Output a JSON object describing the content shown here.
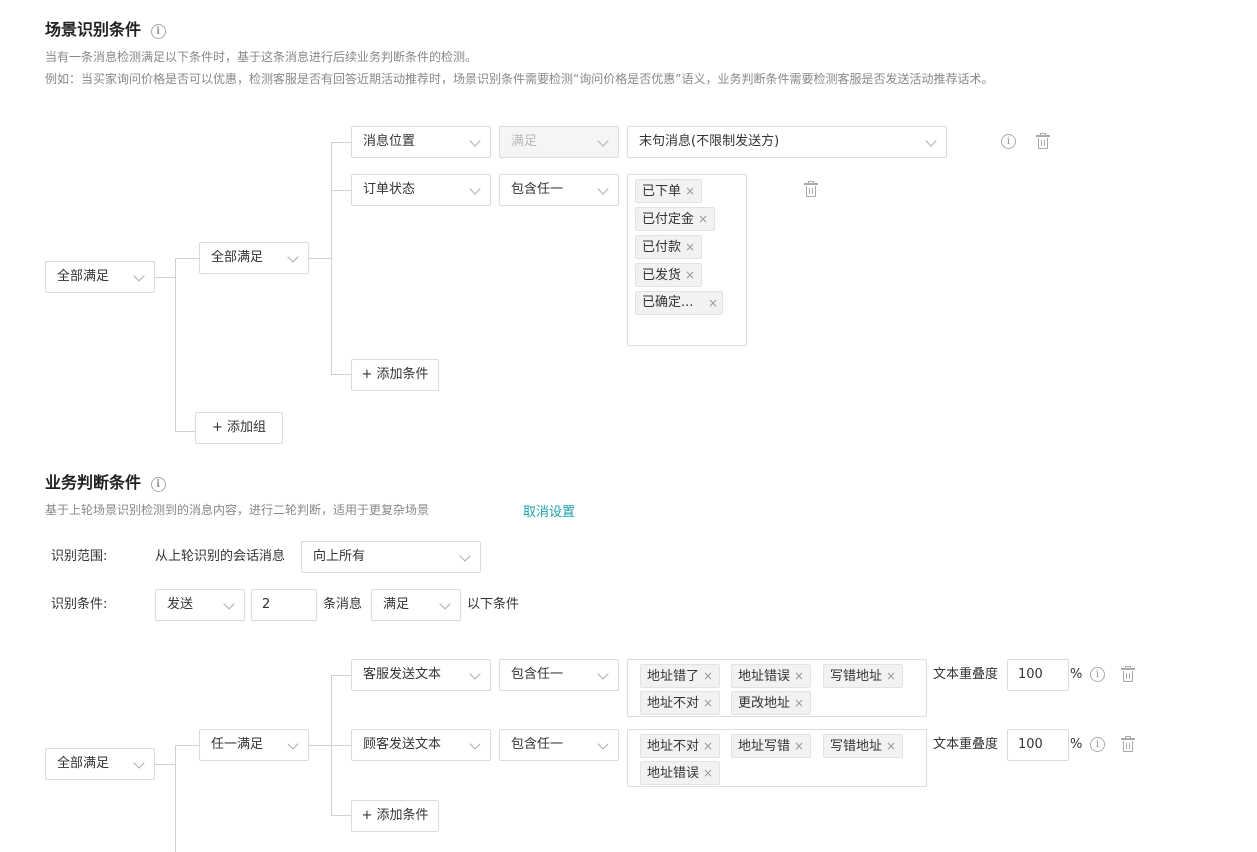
{
  "scene": {
    "title": "场景识别条件",
    "desc1": "当有一条消息检测满足以下条件时，基于这条消息进行后续业务判断条件的检测。",
    "desc2": "例如：当买家询问价格是否可以优惠，检测客服是否有回答近期活动推荐时，场景识别条件需要检测“询问价格是否优惠”语义，业务判断条件需要检测客服是否发送活动推荐话术。",
    "root_mode": "全部满足",
    "group_mode": "全部满足",
    "row1": {
      "field": "消息位置",
      "op": "满足",
      "value": "末句消息(不限制发送方)"
    },
    "row2": {
      "field": "订单状态",
      "op": "包含任一",
      "tags": [
        "已下单",
        "已付定金",
        "已付款",
        "已发货",
        "已确定..."
      ]
    },
    "add_condition": "+ 添加条件",
    "add_group": "+ 添加组"
  },
  "business": {
    "title": "业务判断条件",
    "desc": "基于上轮场景识别检测到的消息内容，进行二轮判断，适用于更复杂场景",
    "cancel": "取消设置",
    "range_label": "识别范围:",
    "range_prefix": "从上轮识别的会话消息",
    "range_value": "向上所有",
    "cond_label": "识别条件:",
    "cond_send": "发送",
    "cond_count": "2",
    "cond_unit": "条消息",
    "cond_match": "满足",
    "cond_suffix": "以下条件",
    "root_mode": "全部满足",
    "group_mode": "任一满足",
    "row1": {
      "field": "客服发送文本",
      "op": "包含任一",
      "tags": [
        "地址错了",
        "地址错误",
        "写错地址",
        "地址不对",
        "更改地址"
      ],
      "overlap_label": "文本重叠度",
      "overlap": "100",
      "pct": "%"
    },
    "row2": {
      "field": "顾客发送文本",
      "op": "包含任一",
      "tags": [
        "地址不对",
        "地址写错",
        "写错地址",
        "地址错误"
      ],
      "overlap_label": "文本重叠度",
      "overlap": "100",
      "pct": "%"
    },
    "add_condition": "+ 添加条件"
  },
  "icons": {
    "info": "info-icon",
    "delete": "trash-icon",
    "dropdown": "chevron-down-icon",
    "remove": "close-icon"
  }
}
